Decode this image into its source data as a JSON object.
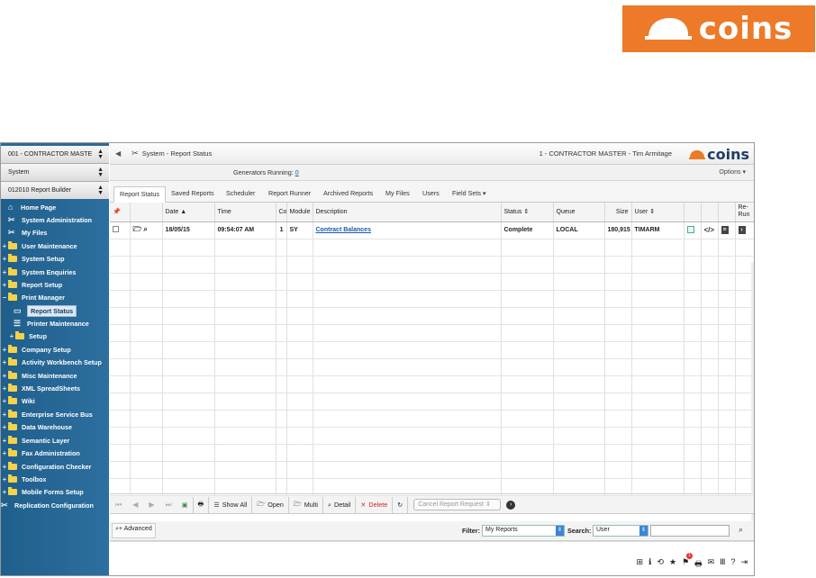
{
  "brand": {
    "logo_word": "coins",
    "accent": "#ec7a28"
  },
  "sidebar": {
    "selects": [
      "001 - CONTRACTOR MASTE",
      "System",
      "012010 Report Builder"
    ],
    "items": [
      {
        "label": "Home Page",
        "icon": "home-icon"
      },
      {
        "label": "System Administration",
        "icon": "tools-icon"
      },
      {
        "label": "My Files",
        "icon": "tools-icon"
      },
      {
        "label": "User Maintenance",
        "icon": "folder-icon"
      },
      {
        "label": "System Setup",
        "icon": "folder-icon"
      },
      {
        "label": "System Enquiries",
        "icon": "folder-icon"
      },
      {
        "label": "Report Setup",
        "icon": "folder-icon"
      },
      {
        "label": "Print Manager",
        "icon": "folder-icon"
      },
      {
        "label": "Report Status",
        "icon": "report-icon"
      },
      {
        "label": "Printer Maintenance",
        "icon": "list-icon"
      },
      {
        "label": "Setup",
        "icon": "folder-icon"
      },
      {
        "label": "Company Setup",
        "icon": "folder-icon"
      },
      {
        "label": "Activity Workbench Setup",
        "icon": "folder-icon"
      },
      {
        "label": "Misc Maintenance",
        "icon": "folder-icon"
      },
      {
        "label": "XML SpreadSheets",
        "icon": "folder-icon"
      },
      {
        "label": "Wiki",
        "icon": "folder-icon"
      },
      {
        "label": "Enterprise Service Bus",
        "icon": "folder-icon"
      },
      {
        "label": "Data Warehouse",
        "icon": "folder-icon"
      },
      {
        "label": "Semantic Layer",
        "icon": "folder-icon"
      },
      {
        "label": "Fax Administration",
        "icon": "folder-icon"
      },
      {
        "label": "Configuration Checker",
        "icon": "folder-icon"
      },
      {
        "label": "Toolbox",
        "icon": "folder-icon"
      },
      {
        "label": "Mobile Forms Setup",
        "icon": "folder-icon"
      },
      {
        "label": "Replication Configuration",
        "icon": "tools-icon"
      }
    ]
  },
  "header": {
    "breadcrumb": "System - Report Status",
    "context": "1 - CONTRACTOR MASTER - Tim Armitage",
    "generators_label": "Generators Running:",
    "generators_count": "0",
    "options": "Options"
  },
  "tabs": [
    "Report Status",
    "Saved Reports",
    "Scheduler",
    "Report Runner",
    "Archived Reports",
    "My Files",
    "Users",
    "Field Sets"
  ],
  "table": {
    "headers": {
      "date": "Date",
      "time": "Time",
      "co": "Co",
      "module": "Module",
      "description": "Description",
      "status": "Status",
      "queue": "Queue",
      "size": "Size",
      "user": "User",
      "rerun": "Re-Run"
    },
    "rows": [
      {
        "date": "18/05/15",
        "time": "09:54:07 AM",
        "co": "1",
        "module": "SY",
        "description": "Contract Balances",
        "status": "Complete",
        "queue": "LOCAL",
        "size": "180,915",
        "user": "TIMARM"
      }
    ]
  },
  "toolbar": {
    "show_all": "Show All",
    "open": "Open",
    "multi": "Multi",
    "detail": "Detail",
    "delete": "Delete",
    "cancel_request": "Cancel Report Request"
  },
  "filter": {
    "advanced": "Advanced",
    "filter_label": "Filter:",
    "filter_value": "My Reports",
    "search_label": "Search:",
    "search_value": "User",
    "search_text": ""
  }
}
